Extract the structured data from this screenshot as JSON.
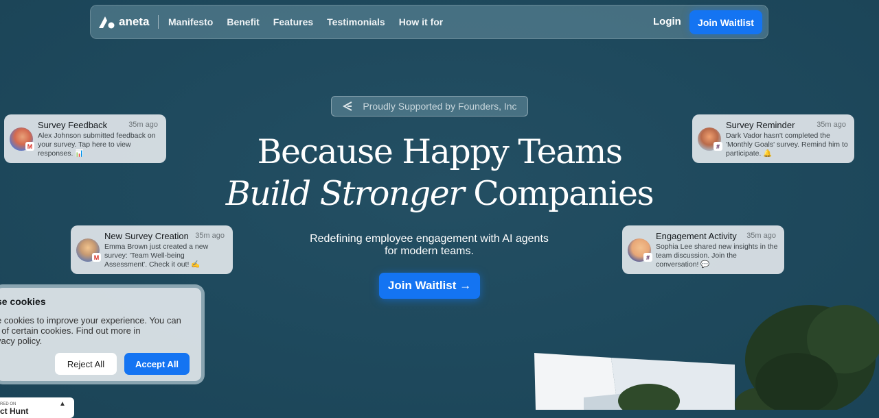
{
  "nav": {
    "logo_text": "aneta",
    "links": [
      "Manifesto",
      "Benefit",
      "Features",
      "Testimonials",
      "How it for"
    ],
    "login": "Login",
    "cta": "Join Waitlist"
  },
  "hero": {
    "badge": "Proudly Supported by Founders, Inc",
    "headline_line1": "Because Happy Teams",
    "headline_italic": "Build Stronger",
    "headline_line2_rest": " Companies",
    "subtitle_line1": "Redefining employee engagement with AI agents",
    "subtitle_line2": "for modern teams.",
    "cta": "Join Waitlist →"
  },
  "cards": [
    {
      "title": "Survey Feedback",
      "time": "35m ago",
      "body": "Alex Johnson submitted feedback on your survey. Tap here to view responses. 📊",
      "app": "gmail-icon"
    },
    {
      "title": "New Survey Creation",
      "time": "35m ago",
      "body": "Emma Brown just created a new survey: 'Team Well-being Assessment'. Check it out! ✍️",
      "app": "gmail-icon"
    },
    {
      "title": "Survey Reminder",
      "time": "35m ago",
      "body": "Dark Vador hasn't completed the 'Monthly Goals' survey. Remind him to participate. 🔔",
      "app": "slack-icon"
    },
    {
      "title": "Engagement Activity",
      "time": "35m ago",
      "body": "Sophia Lee shared new insights in the team discussion. Join the conversation! 💬",
      "app": "slack-icon"
    }
  ],
  "cookie": {
    "title": "se cookies",
    "text_line1": "e cookies to improve your experience. You can",
    "text_line2": "t of certain cookies. Find out more in",
    "text_line3": "vacy policy.",
    "reject": "Reject All",
    "accept": "Accept All"
  },
  "product_hunt": {
    "small_text": "RED ON",
    "name": "ct Hunt"
  },
  "colors": {
    "background": "#1f4a5e",
    "accent": "#1474f2"
  }
}
